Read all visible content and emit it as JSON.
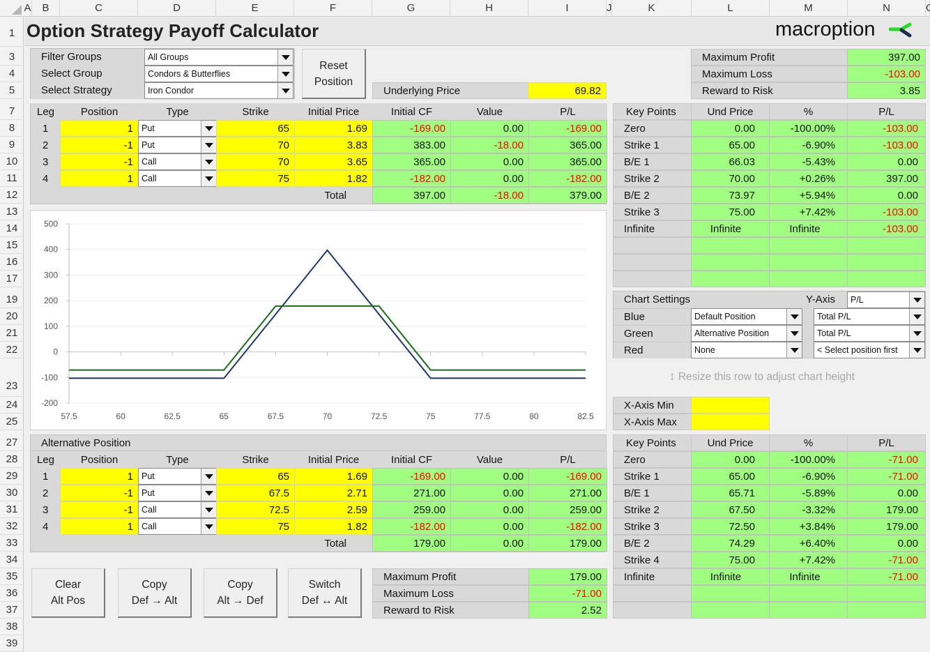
{
  "app": {
    "title": "Option Strategy Payoff Calculator",
    "logo_text": "macroption",
    "logo_icon": "macroption-check-mark-icon"
  },
  "grid": {
    "columns": [
      "A",
      "B",
      "C",
      "D",
      "E",
      "F",
      "G",
      "H",
      "I",
      "J",
      "K",
      "L",
      "M",
      "N",
      "O"
    ],
    "rows": [
      "1",
      "3",
      "4",
      "5",
      "7",
      "8",
      "9",
      "10",
      "11",
      "12",
      "13",
      "14",
      "15",
      "16",
      "17",
      "19",
      "20",
      "21",
      "22",
      "23",
      "24",
      "25",
      "27",
      "28",
      "29",
      "30",
      "31",
      "32",
      "33",
      "34",
      "35",
      "36",
      "37",
      "38",
      "39"
    ]
  },
  "selectors": {
    "filter_groups": {
      "label": "Filter Groups",
      "value": "All Groups"
    },
    "select_group": {
      "label": "Select Group",
      "value": "Condors & Butterflies"
    },
    "select_strategy": {
      "label": "Select Strategy",
      "value": "Iron Condor"
    },
    "reset_button": {
      "line1": "Reset",
      "line2": "Position"
    }
  },
  "underlying": {
    "label": "Underlying Price",
    "value": "69.82"
  },
  "default_summary": [
    {
      "label": "Maximum Profit",
      "value": "397.00",
      "negative": false
    },
    {
      "label": "Maximum Loss",
      "value": "-103.00",
      "negative": true
    },
    {
      "label": "Reward to Risk",
      "value": "3.85",
      "negative": false
    }
  ],
  "legs_table": {
    "headers": [
      "Leg",
      "Position",
      "Type",
      "Strike",
      "Initial Price",
      "Initial CF",
      "Value",
      "P/L"
    ],
    "rows": [
      {
        "leg": "1",
        "position": "1",
        "type": "Put",
        "strike": "65",
        "price": "1.69",
        "cf": "-169.00",
        "value": "0.00",
        "pl": "-169.00"
      },
      {
        "leg": "2",
        "position": "-1",
        "type": "Put",
        "strike": "70",
        "price": "3.83",
        "cf": "383.00",
        "value": "-18.00",
        "pl": "365.00"
      },
      {
        "leg": "3",
        "position": "-1",
        "type": "Call",
        "strike": "70",
        "price": "3.65",
        "cf": "365.00",
        "value": "0.00",
        "pl": "365.00"
      },
      {
        "leg": "4",
        "position": "1",
        "type": "Call",
        "strike": "75",
        "price": "1.82",
        "cf": "-182.00",
        "value": "0.00",
        "pl": "-182.00"
      }
    ],
    "total_label": "Total",
    "total": {
      "cf": "397.00",
      "value": "-18.00",
      "pl": "379.00"
    }
  },
  "key_points_default": {
    "headers": [
      "Key Points",
      "Und Price",
      "%",
      "P/L"
    ],
    "rows": [
      {
        "name": "Zero",
        "price": "0.00",
        "pct": "-100.00%",
        "pl": "-103.00"
      },
      {
        "name": "Strike 1",
        "price": "65.00",
        "pct": "-6.90%",
        "pl": "-103.00"
      },
      {
        "name": "B/E 1",
        "price": "66.03",
        "pct": "-5.43%",
        "pl": "0.00"
      },
      {
        "name": "Strike 2",
        "price": "70.00",
        "pct": "+0.26%",
        "pl": "397.00"
      },
      {
        "name": "B/E 2",
        "price": "73.97",
        "pct": "+5.94%",
        "pl": "0.00"
      },
      {
        "name": "Strike 3",
        "price": "75.00",
        "pct": "+7.42%",
        "pl": "-103.00"
      },
      {
        "name": "Infinite",
        "price": "Infinite",
        "pct": "Infinite",
        "pl": "-103.00"
      },
      {
        "name": "",
        "price": "",
        "pct": "",
        "pl": ""
      },
      {
        "name": "",
        "price": "",
        "pct": "",
        "pl": ""
      },
      {
        "name": "",
        "price": "",
        "pct": "",
        "pl": ""
      }
    ]
  },
  "chart_settings": {
    "title": "Chart Settings",
    "y_axis_label": "Y-Axis",
    "y_axis_value": "P/L",
    "rows": [
      {
        "label": "Blue",
        "position": "Default Position",
        "series": "Total P/L"
      },
      {
        "label": "Green",
        "position": "Alternative Position",
        "series": "Total P/L"
      },
      {
        "label": "Red",
        "position": "None",
        "series": "< Select position first"
      }
    ],
    "resize_hint": "Resize this row to adjust chart height",
    "x_axis_min_label": "X-Axis Min",
    "x_axis_min_value": "",
    "x_axis_max_label": "X-Axis Max",
    "x_axis_max_value": ""
  },
  "chart_data": {
    "type": "line",
    "title": "",
    "xlabel": "",
    "ylabel": "",
    "xlim": [
      57.5,
      82.5
    ],
    "ylim": [
      -200,
      500
    ],
    "x_ticks": [
      "57.5",
      "60",
      "62.5",
      "65",
      "67.5",
      "70",
      "72.5",
      "75",
      "77.5",
      "80",
      "82.5"
    ],
    "y_ticks": [
      "500",
      "400",
      "300",
      "200",
      "100",
      "0",
      "-100",
      "-200"
    ],
    "grid": true,
    "legend": "none",
    "series": [
      {
        "name": "Default Position Total P/L",
        "color": "#1f3864",
        "x": [
          57.5,
          65,
          70,
          75,
          82.5
        ],
        "y": [
          -103,
          -103,
          397,
          -103,
          -103
        ]
      },
      {
        "name": "Alternative Position Total P/L",
        "color": "#1a6b1a",
        "x": [
          57.5,
          65,
          67.5,
          72.5,
          75,
          82.5
        ],
        "y": [
          -71,
          -71,
          179,
          179,
          -71,
          -71
        ]
      }
    ]
  },
  "alt_position": {
    "title": "Alternative Position",
    "headers": [
      "Leg",
      "Position",
      "Type",
      "Strike",
      "Initial Price",
      "Initial CF",
      "Value",
      "P/L"
    ],
    "rows": [
      {
        "leg": "1",
        "position": "1",
        "type": "Put",
        "strike": "65",
        "price": "1.69",
        "cf": "-169.00",
        "value": "0.00",
        "pl": "-169.00"
      },
      {
        "leg": "2",
        "position": "-1",
        "type": "Put",
        "strike": "67.5",
        "price": "2.71",
        "cf": "271.00",
        "value": "0.00",
        "pl": "271.00"
      },
      {
        "leg": "3",
        "position": "-1",
        "type": "Call",
        "strike": "72.5",
        "price": "2.59",
        "cf": "259.00",
        "value": "0.00",
        "pl": "259.00"
      },
      {
        "leg": "4",
        "position": "1",
        "type": "Call",
        "strike": "75",
        "price": "1.82",
        "cf": "-182.00",
        "value": "0.00",
        "pl": "-182.00"
      }
    ],
    "total_label": "Total",
    "total": {
      "cf": "179.00",
      "value": "0.00",
      "pl": "179.00"
    }
  },
  "key_points_alt": {
    "headers": [
      "Key Points",
      "Und Price",
      "%",
      "P/L"
    ],
    "rows": [
      {
        "name": "Zero",
        "price": "0.00",
        "pct": "-100.00%",
        "pl": "-71.00"
      },
      {
        "name": "Strike 1",
        "price": "65.00",
        "pct": "-6.90%",
        "pl": "-71.00"
      },
      {
        "name": "B/E 1",
        "price": "65.71",
        "pct": "-5.89%",
        "pl": "0.00"
      },
      {
        "name": "Strike 2",
        "price": "67.50",
        "pct": "-3.32%",
        "pl": "179.00"
      },
      {
        "name": "Strike 3",
        "price": "72.50",
        "pct": "+3.84%",
        "pl": "179.00"
      },
      {
        "name": "B/E 2",
        "price": "74.29",
        "pct": "+6.40%",
        "pl": "0.00"
      },
      {
        "name": "Strike 4",
        "price": "75.00",
        "pct": "+7.42%",
        "pl": "-71.00"
      },
      {
        "name": "Infinite",
        "price": "Infinite",
        "pct": "Infinite",
        "pl": "-71.00"
      },
      {
        "name": "",
        "price": "",
        "pct": "",
        "pl": ""
      },
      {
        "name": "",
        "price": "",
        "pct": "",
        "pl": ""
      }
    ]
  },
  "alt_buttons": [
    {
      "line1": "Clear",
      "line2": "Alt Pos"
    },
    {
      "line1": "Copy",
      "line2": "Def → Alt"
    },
    {
      "line1": "Copy",
      "line2": "Alt → Def"
    },
    {
      "line1": "Switch",
      "line2": "Def ↔ Alt"
    }
  ],
  "alt_summary": [
    {
      "label": "Maximum Profit",
      "value": "179.00",
      "negative": false
    },
    {
      "label": "Maximum Loss",
      "value": "-71.00",
      "negative": true
    },
    {
      "label": "Reward to Risk",
      "value": "2.52",
      "negative": false
    }
  ]
}
